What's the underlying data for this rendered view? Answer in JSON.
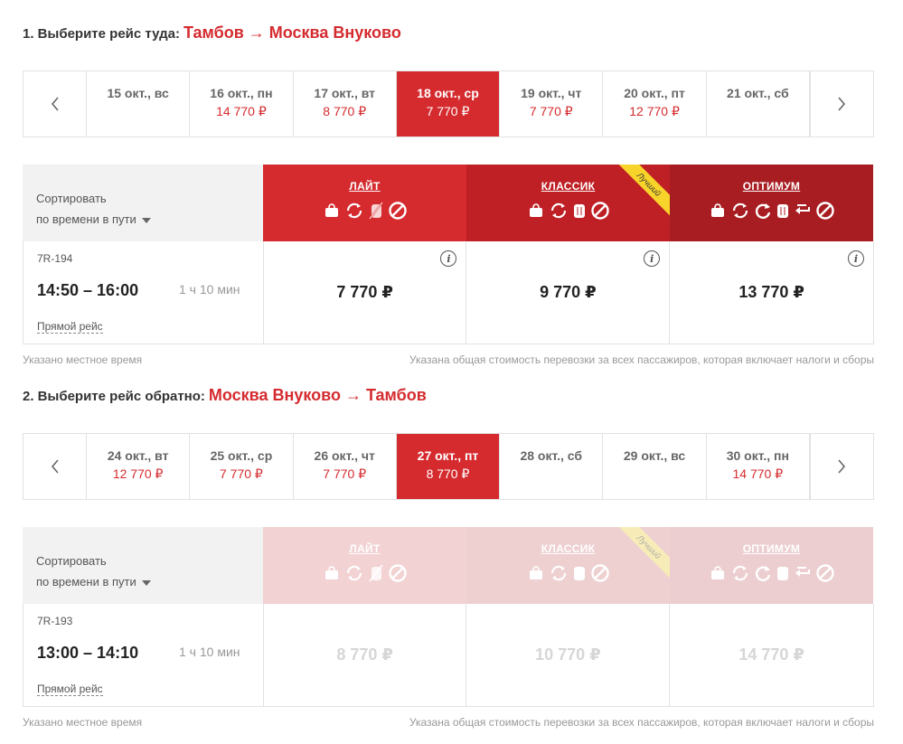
{
  "outbound": {
    "label": "1. Выберите рейс туда:",
    "route": "Тамбов → Москва Внуково",
    "dates": [
      {
        "date": "15 окт., вс",
        "price": ""
      },
      {
        "date": "16 окт., пн",
        "price": "14 770 ₽"
      },
      {
        "date": "17 окт., вт",
        "price": "8 770 ₽"
      },
      {
        "date": "18 окт., ср",
        "price": "7 770 ₽",
        "active": true
      },
      {
        "date": "19 окт., чт",
        "price": "7 770 ₽"
      },
      {
        "date": "20 окт., пт",
        "price": "12 770 ₽"
      },
      {
        "date": "21 окт., сб",
        "price": ""
      }
    ],
    "sort_label": "Сортировать",
    "sort_value": "по времени в пути",
    "tariffs": [
      {
        "name": "ЛАЙТ",
        "icons": [
          "handbag-icon",
          "exchange-icon",
          "no-luggage-icon",
          "no-refund-icon"
        ]
      },
      {
        "name": "КЛАССИК",
        "badge": "Лучший",
        "icons": [
          "handbag-icon",
          "exchange-icon",
          "luggage-icon",
          "no-refund-icon"
        ]
      },
      {
        "name": "ОПТИМУМ",
        "icons": [
          "handbag-icon",
          "exchange-icon",
          "rebook-icon",
          "luggage-icon",
          "refund-icon",
          "no-icon"
        ]
      }
    ],
    "flight": {
      "number": "7R-194",
      "time": "14:50 – 16:00",
      "duration": "1 ч 10 мин",
      "type": "Прямой рейс",
      "prices": [
        "7 770 ₽",
        "9 770 ₽",
        "13 770 ₽"
      ]
    },
    "note_left": "Указано местное время",
    "note_right": "Указана общая стоимость перевозки за всех пассажиров, которая включает налоги и сборы"
  },
  "return": {
    "label": "2. Выберите рейс обратно:",
    "route": "Москва Внуково → Тамбов",
    "dates": [
      {
        "date": "24 окт., вт",
        "price": "12 770 ₽"
      },
      {
        "date": "25 окт., ср",
        "price": "7 770 ₽"
      },
      {
        "date": "26 окт., чт",
        "price": "7 770 ₽"
      },
      {
        "date": "27 окт., пт",
        "price": "8 770 ₽",
        "active": true
      },
      {
        "date": "28 окт., сб",
        "price": ""
      },
      {
        "date": "29 окт., вс",
        "price": ""
      },
      {
        "date": "30 окт., пн",
        "price": "14 770 ₽"
      }
    ],
    "sort_label": "Сортировать",
    "sort_value": "по времени в пути",
    "tariffs": [
      {
        "name": "ЛАЙТ"
      },
      {
        "name": "КЛАССИК",
        "badge": "Лучший"
      },
      {
        "name": "ОПТИМУМ"
      }
    ],
    "flight": {
      "number": "7R-193",
      "time": "13:00 – 14:10",
      "duration": "1 ч 10 мин",
      "type": "Прямой рейс",
      "prices": [
        "8 770 ₽",
        "10 770 ₽",
        "14 770 ₽"
      ]
    },
    "note_left": "Указано местное время",
    "note_right": "Указана общая стоимость перевозки за всех пассажиров, которая включает налоги и сборы"
  },
  "colors": {
    "accent": "#d52b2f",
    "classic": "#bf2025",
    "optimum": "#a81d22",
    "badge": "#f8d42b"
  }
}
